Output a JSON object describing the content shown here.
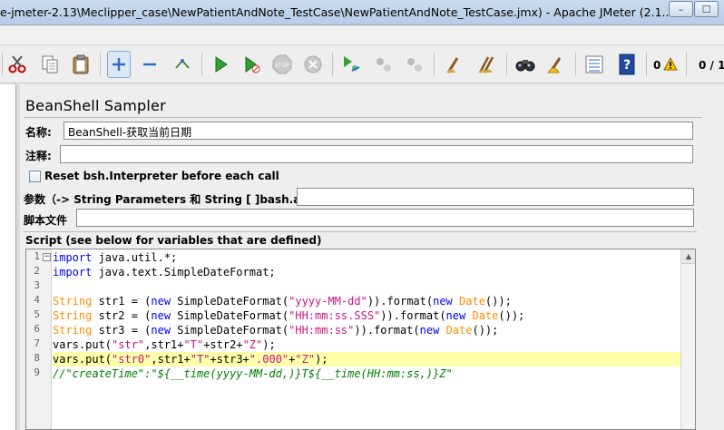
{
  "window": {
    "title": "e-jmeter-2.13\\Meclipper_case\\NewPatientAndNote_TestCase\\NewPatientAndNote_TestCase.jmx) - Apache JMeter (2.1...",
    "minimize": "–",
    "maximize": "☐"
  },
  "toolbar": {
    "error_count": "0",
    "thread_count": "0 / 1"
  },
  "sampler": {
    "title": "BeanShell Sampler",
    "name_label": "名称:",
    "name_value": "BeanShell-获取当前日期",
    "comment_label": "注释:",
    "comment_value": "",
    "reset_label": "Reset bsh.Interpreter before each call",
    "params_label": "参数（-> String Parameters 和 String [ ]bash.args）",
    "params_value": "",
    "script_file_label": "脚本文件",
    "script_file_value": "",
    "script_label": "Script (see below for variables that are defined)"
  },
  "script": {
    "line_numbers": [
      "1",
      "2",
      "3",
      "4",
      "5",
      "6",
      "7",
      "8",
      "9"
    ],
    "lines": [
      [
        [
          "kw",
          "import"
        ],
        [
          "cls",
          " java.util.*;"
        ]
      ],
      [
        [
          "kw",
          "import"
        ],
        [
          "cls",
          " java.text.SimpleDateFormat;"
        ]
      ],
      [],
      [
        [
          "ty",
          "String"
        ],
        [
          "cls",
          " str1 = ("
        ],
        [
          "kw",
          "new"
        ],
        [
          "cls",
          " SimpleDateFormat("
        ],
        [
          "st",
          "\"yyyy-MM-dd\""
        ],
        [
          "cls",
          "))."
        ],
        [
          "cls",
          "format("
        ],
        [
          "kw",
          "new"
        ],
        [
          "cls",
          " "
        ],
        [
          "ty",
          "Date"
        ],
        [
          "cls",
          "());"
        ]
      ],
      [
        [
          "ty",
          "String"
        ],
        [
          "cls",
          " str2 = ("
        ],
        [
          "kw",
          "new"
        ],
        [
          "cls",
          " SimpleDateFormat("
        ],
        [
          "st",
          "\"HH:mm:ss.SSS\""
        ],
        [
          "cls",
          "))."
        ],
        [
          "cls",
          "format("
        ],
        [
          "kw",
          "new"
        ],
        [
          "cls",
          " "
        ],
        [
          "ty",
          "Date"
        ],
        [
          "cls",
          "());"
        ]
      ],
      [
        [
          "ty",
          "String"
        ],
        [
          "cls",
          " str3 = ("
        ],
        [
          "kw",
          "new"
        ],
        [
          "cls",
          " SimpleDateFormat("
        ],
        [
          "st",
          "\"HH:mm:ss\""
        ],
        [
          "cls",
          "))."
        ],
        [
          "cls",
          "format("
        ],
        [
          "kw",
          "new"
        ],
        [
          "cls",
          " "
        ],
        [
          "ty",
          "Date"
        ],
        [
          "cls",
          "());"
        ]
      ],
      [
        [
          "cls",
          "vars.put("
        ],
        [
          "st",
          "\"str\""
        ],
        [
          "cls",
          ",str1+"
        ],
        [
          "st",
          "\"T\""
        ],
        [
          "cls",
          "+str2+"
        ],
        [
          "st",
          "\"Z\""
        ],
        [
          "cls",
          ");"
        ]
      ],
      [
        [
          "cls",
          "vars.put("
        ],
        [
          "st",
          "\"str0\""
        ],
        [
          "cls",
          ",str1+"
        ],
        [
          "st",
          "\"T\""
        ],
        [
          "cls",
          "+str3+"
        ],
        [
          "st",
          "\".000\""
        ],
        [
          "cls",
          "+"
        ],
        [
          "st",
          "\"Z\""
        ],
        [
          "cls",
          ");"
        ]
      ],
      [
        [
          "cm",
          "//\"createTime\":\"${__time(yyyy-MM-dd,)}T${__time(HH:mm:ss,)}Z\""
        ]
      ]
    ],
    "highlighted_line": 8
  },
  "colors": {
    "keyword": "#0000ff",
    "type": "#ff8c00",
    "string": "#c71585",
    "comment": "#008000",
    "highlight": "#ffffaa"
  }
}
